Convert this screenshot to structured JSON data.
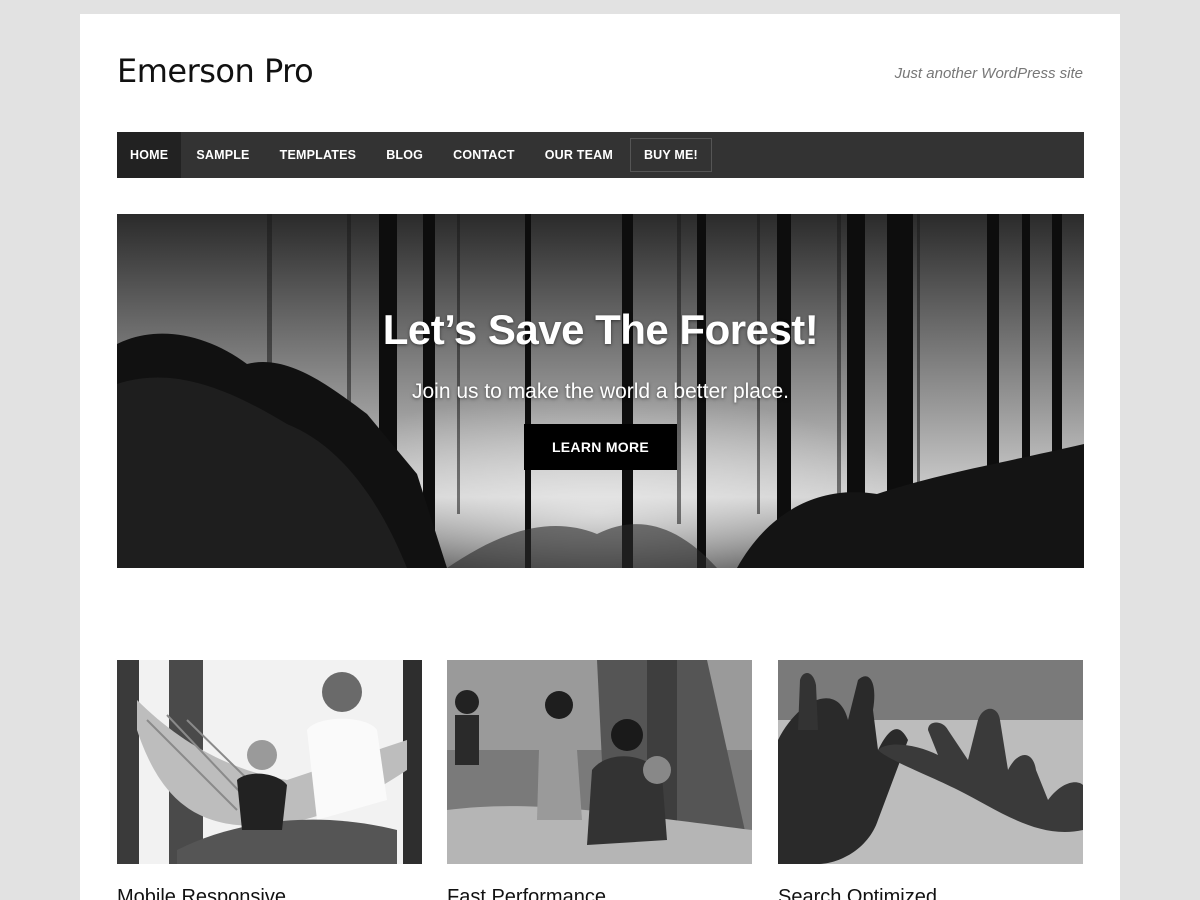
{
  "site": {
    "title": "Emerson Pro",
    "tagline": "Just another WordPress site"
  },
  "nav": {
    "items": [
      {
        "label": "HOME",
        "active": true
      },
      {
        "label": "SAMPLE"
      },
      {
        "label": "TEMPLATES"
      },
      {
        "label": "BLOG"
      },
      {
        "label": "CONTACT"
      },
      {
        "label": "OUR TEAM"
      },
      {
        "label": "BUY ME!"
      }
    ]
  },
  "hero": {
    "title": "Let’s Save The Forest!",
    "subtitle": "Join us to make the world a better place.",
    "button_label": "LEARN MORE"
  },
  "features": [
    {
      "title": "Mobile Responsive",
      "image": "father-child-hammock-photo"
    },
    {
      "title": "Fast Performance",
      "image": "children-village-photo"
    },
    {
      "title": "Search Optimized",
      "image": "hands-reaching-photo"
    }
  ],
  "colors": {
    "nav_bg": "#333333",
    "nav_active_bg": "#222222",
    "button_bg": "#000000",
    "page_bg": "#e2e2e2"
  }
}
